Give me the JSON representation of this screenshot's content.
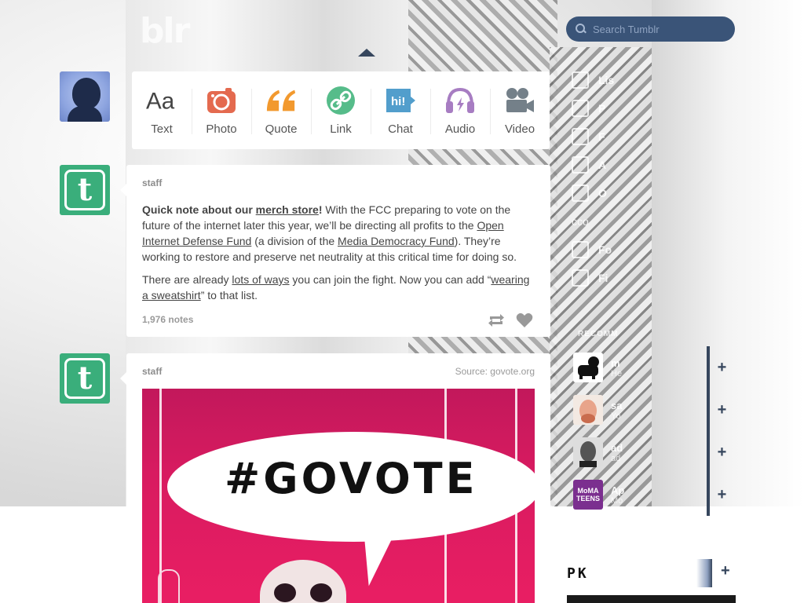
{
  "header": {
    "logo_text": "blr",
    "search_placeholder": "Search Tumblr"
  },
  "composer": {
    "items": [
      {
        "label": "Text",
        "icon": "text-icon",
        "color": "#444444"
      },
      {
        "label": "Photo",
        "icon": "camera-icon",
        "color": "#e46a4f"
      },
      {
        "label": "Quote",
        "icon": "quote-icon",
        "color": "#f2992e"
      },
      {
        "label": "Link",
        "icon": "link-icon",
        "color": "#56bc8a"
      },
      {
        "label": "Chat",
        "icon": "chat-icon",
        "color": "#529ecc"
      },
      {
        "label": "Audio",
        "icon": "headphones-icon",
        "color": "#a77dc2"
      },
      {
        "label": "Video",
        "icon": "video-camera-icon",
        "color": "#748089"
      }
    ]
  },
  "posts": [
    {
      "author": "staff",
      "p1": {
        "bold": "Quick note about our ",
        "link1": "merch store",
        "bold_end": "!",
        "t1": " With the FCC preparing to vote on the future of the internet later this year, we’ll be directing all profits to the ",
        "link2": "Open Internet Defense Fund",
        "t2": " (a division of the ",
        "link3": "Media Democracy Fund",
        "t3": "). They’re working to restore and preserve net neutrality at this critical time for doing so."
      },
      "p2": {
        "t1": "There are already ",
        "link1": "lots of ways",
        "t2": " you can join the fight. Now you can add “",
        "link2": "wearing a sweatshirt",
        "t3": "” to that list."
      },
      "notes": "1,976 notes"
    },
    {
      "author": "staff",
      "source": "Source: govote.org",
      "image_text": "#GOVOTE"
    }
  ],
  "sidebar": {
    "menu": [
      "Lis",
      "P",
      "F",
      "A",
      "O"
    ],
    "account_label": "cco",
    "follow_label": "Fo",
    "find_label": "Fi",
    "recommended_label": "RECOMM",
    "recommended": [
      {
        "name": "m",
        "sub": "He"
      },
      {
        "name": "sa",
        "sub": "Yo"
      },
      {
        "name": "ad",
        "sub": "ad"
      },
      {
        "name": "Ap",
        "sub": "Mo",
        "avatar_text": "MoMA TEENS"
      }
    ],
    "follow_symbol": "+",
    "radar_title": "PK",
    "radar_follow": "+"
  },
  "colors": {
    "accent": "#36465d",
    "staff_green": "#3aae7b",
    "govote_pink": "#d81b60"
  }
}
